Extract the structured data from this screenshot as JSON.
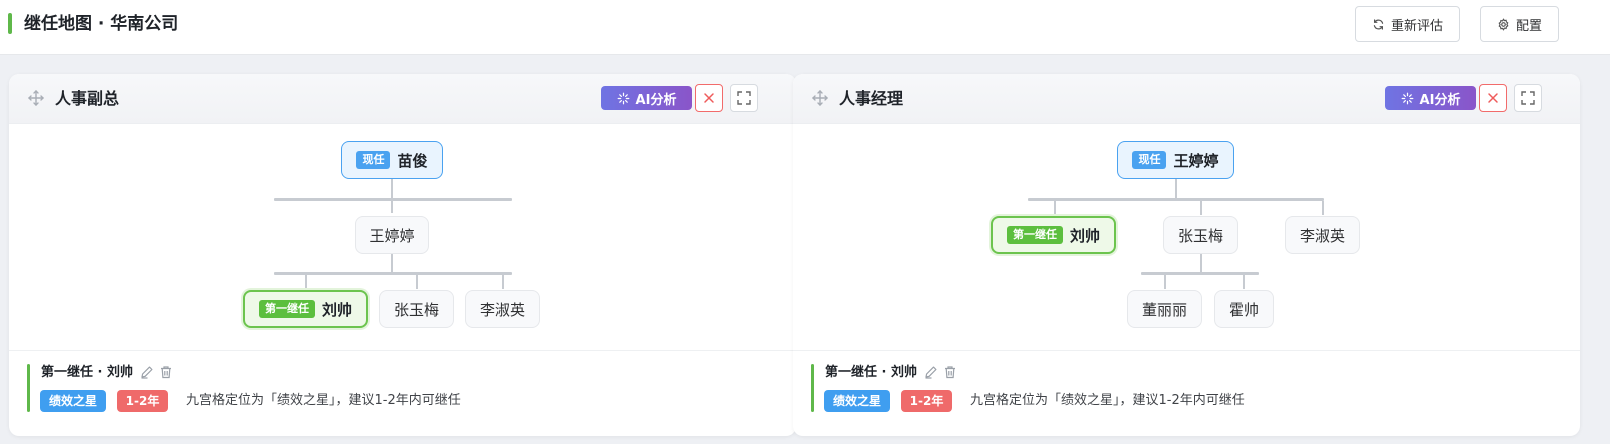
{
  "header": {
    "title": "继任地图 · 华南公司",
    "reassess_label": "重新评估",
    "config_label": "配置"
  },
  "colors": {
    "accent_green": "#5fb84a",
    "current_blue": "#4aa2f0",
    "first_green": "#5cbf3e",
    "ai_gradient_start": "#6f74e3",
    "ai_gradient_end": "#8a55c9",
    "danger_red": "#ef6a6a"
  },
  "cards": [
    {
      "title": "人事副总",
      "ai_label": "AI分析",
      "current": {
        "tag": "现任",
        "name": "苗俊"
      },
      "level1": [
        {
          "name": "王婷婷"
        }
      ],
      "level2": [
        {
          "name": "刘帅",
          "tag": "第一继任"
        },
        {
          "name": "张玉梅"
        },
        {
          "name": "李淑英"
        }
      ],
      "footer": {
        "title": "第一继任 · 刘帅",
        "badge1": "绩效之星",
        "badge2": "1-2年",
        "description": "九宫格定位为「绩效之星」，建议1-2年内可继任"
      }
    },
    {
      "title": "人事经理",
      "ai_label": "AI分析",
      "current": {
        "tag": "现任",
        "name": "王婷婷"
      },
      "level1": [
        {
          "name": "刘帅",
          "tag": "第一继任"
        },
        {
          "name": "张玉梅"
        },
        {
          "name": "李淑英"
        }
      ],
      "level2": [
        {
          "name": "董丽丽"
        },
        {
          "name": "霍帅"
        }
      ],
      "footer": {
        "title": "第一继任 · 刘帅",
        "badge1": "绩效之星",
        "badge2": "1-2年",
        "description": "九宫格定位为「绩效之星」，建议1-2年内可继任"
      }
    }
  ]
}
